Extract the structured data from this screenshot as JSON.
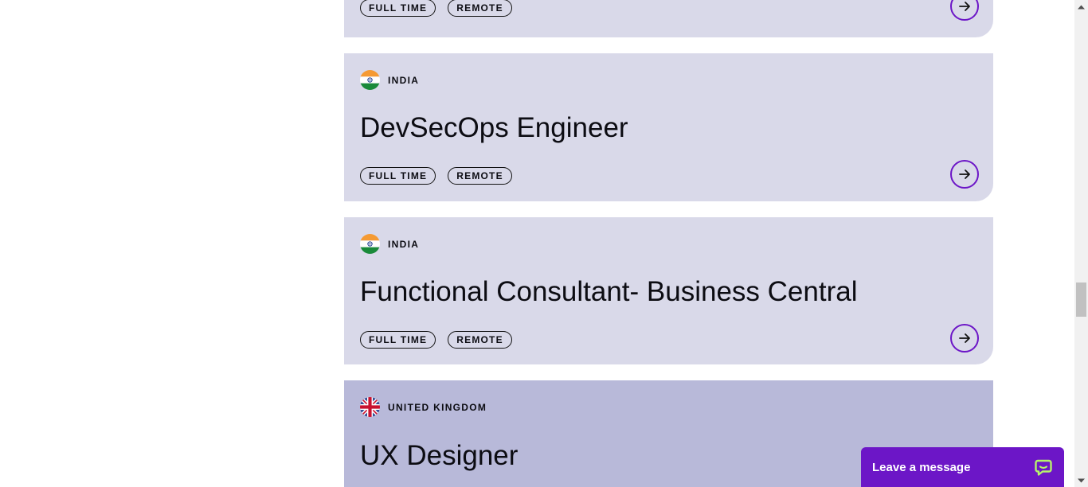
{
  "jobs": [
    {
      "country": "",
      "title": "",
      "tags": [
        "FULL TIME",
        "REMOTE"
      ]
    },
    {
      "country": "INDIA",
      "flag": "india-flag-icon",
      "title": "DevSecOps Engineer",
      "tags": [
        "FULL TIME",
        "REMOTE"
      ]
    },
    {
      "country": "INDIA",
      "flag": "india-flag-icon",
      "title": "Functional Consultant- Business Central",
      "tags": [
        "FULL TIME",
        "REMOTE"
      ]
    },
    {
      "country": "UNITED KINGDOM",
      "flag": "uk-flag-icon",
      "title": "UX Designer",
      "tags": []
    }
  ],
  "chat": {
    "label": "Leave a message",
    "icon": "chat-bubble-icon"
  },
  "colors": {
    "accent": "#6c16c7",
    "card": "#d9d9e9",
    "card_highlight": "#b8b9d9"
  }
}
